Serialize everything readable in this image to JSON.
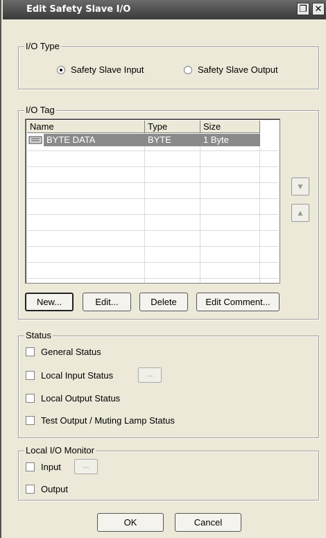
{
  "window": {
    "title": "Edit Safety Slave I/O",
    "restore_glyph": "❐",
    "close_glyph": "✕"
  },
  "io_type": {
    "legend": "I/O Type",
    "input_label": "Safety Slave Input",
    "output_label": "Safety Slave Output",
    "selected": "input"
  },
  "io_tag": {
    "legend": "I/O Tag",
    "columns": [
      "Name",
      "Type",
      "Size"
    ],
    "rows": [
      {
        "name": "BYTE DATA",
        "type": "BYTE",
        "size": "1 Byte"
      }
    ],
    "buttons": {
      "new": "New...",
      "edit": "Edit...",
      "delete": "Delete",
      "edit_comment": "Edit Comment..."
    },
    "side_buttons": {
      "move_down": "▼",
      "move_up": "▲"
    }
  },
  "status": {
    "legend": "Status",
    "general": "General Status",
    "local_input": "Local Input Status",
    "local_output": "Local Output Status",
    "test_output": "Test Output / Muting Lamp Status",
    "ellipsis": "..."
  },
  "monitor": {
    "legend": "Local I/O Monitor",
    "input": "Input",
    "output": "Output",
    "ellipsis": "..."
  },
  "footer": {
    "ok": "OK",
    "cancel": "Cancel"
  }
}
